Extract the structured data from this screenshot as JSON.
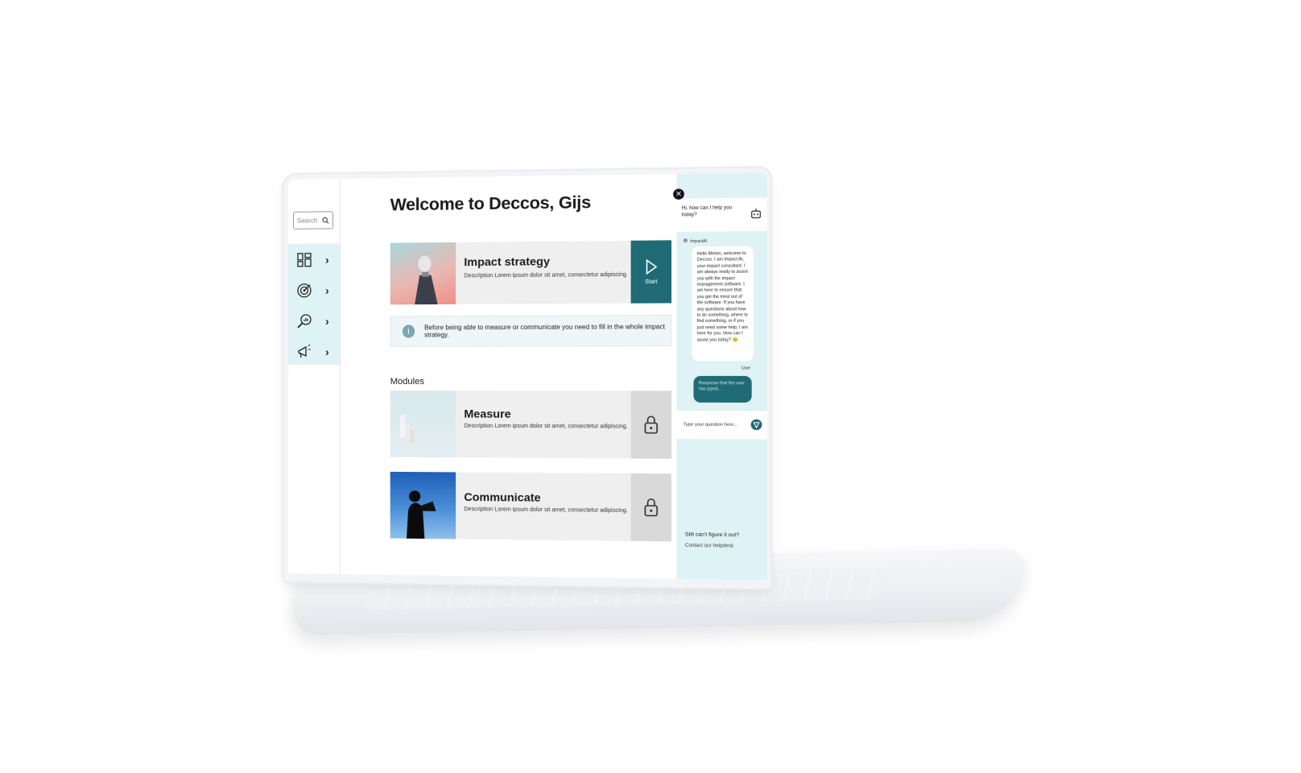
{
  "sidebar": {
    "search_placeholder": "Search",
    "nav": [
      {
        "icon": "dashboard-icon"
      },
      {
        "icon": "target-icon"
      },
      {
        "icon": "analytics-search-icon"
      },
      {
        "icon": "megaphone-icon"
      }
    ]
  },
  "main": {
    "welcome_title": "Welcome to Deccos, Gijs",
    "impact_card": {
      "title": "Impact strategy",
      "description": "Description Lorem ipsum dolor sit amet, consectetur adipiscing.",
      "action_label": "Start"
    },
    "info_message": "Before being able to measure or communicate you need to fill in the whole impact strategy.",
    "modules_label": "Modules",
    "modules": [
      {
        "title": "Measure",
        "description": "Description Lorem ipsum dolor sit amet, consectetur adipiscing."
      },
      {
        "title": "Communicate",
        "description": "Description Lorem ipsum dolor sit amet, consectetur adipiscing."
      }
    ]
  },
  "chat": {
    "greeting": "Hi, how can I help you today?",
    "bot_name": "ImpactAI",
    "bot_message": "Hello Melvin, welcome to Deccos. I am Impact AI, your impact consultant. I am always ready to assist you with the impact management software. I am here to ensure that you get the most out of the software. If you have any questions about how to do something, where to find something, or if you just need some help, I am here for you. How can I assist you today? 😊",
    "user_label": "User",
    "user_message": "Response that the user has typed...",
    "input_placeholder": "Type your question here...",
    "help_title": "Still can't figure it out?",
    "help_link": "Contact our helpdesk"
  },
  "colors": {
    "accent": "#1f6b75",
    "sidebar_bg": "#dff2f6",
    "card_bg": "#efefef",
    "locked_bg": "#d9d9d9"
  }
}
